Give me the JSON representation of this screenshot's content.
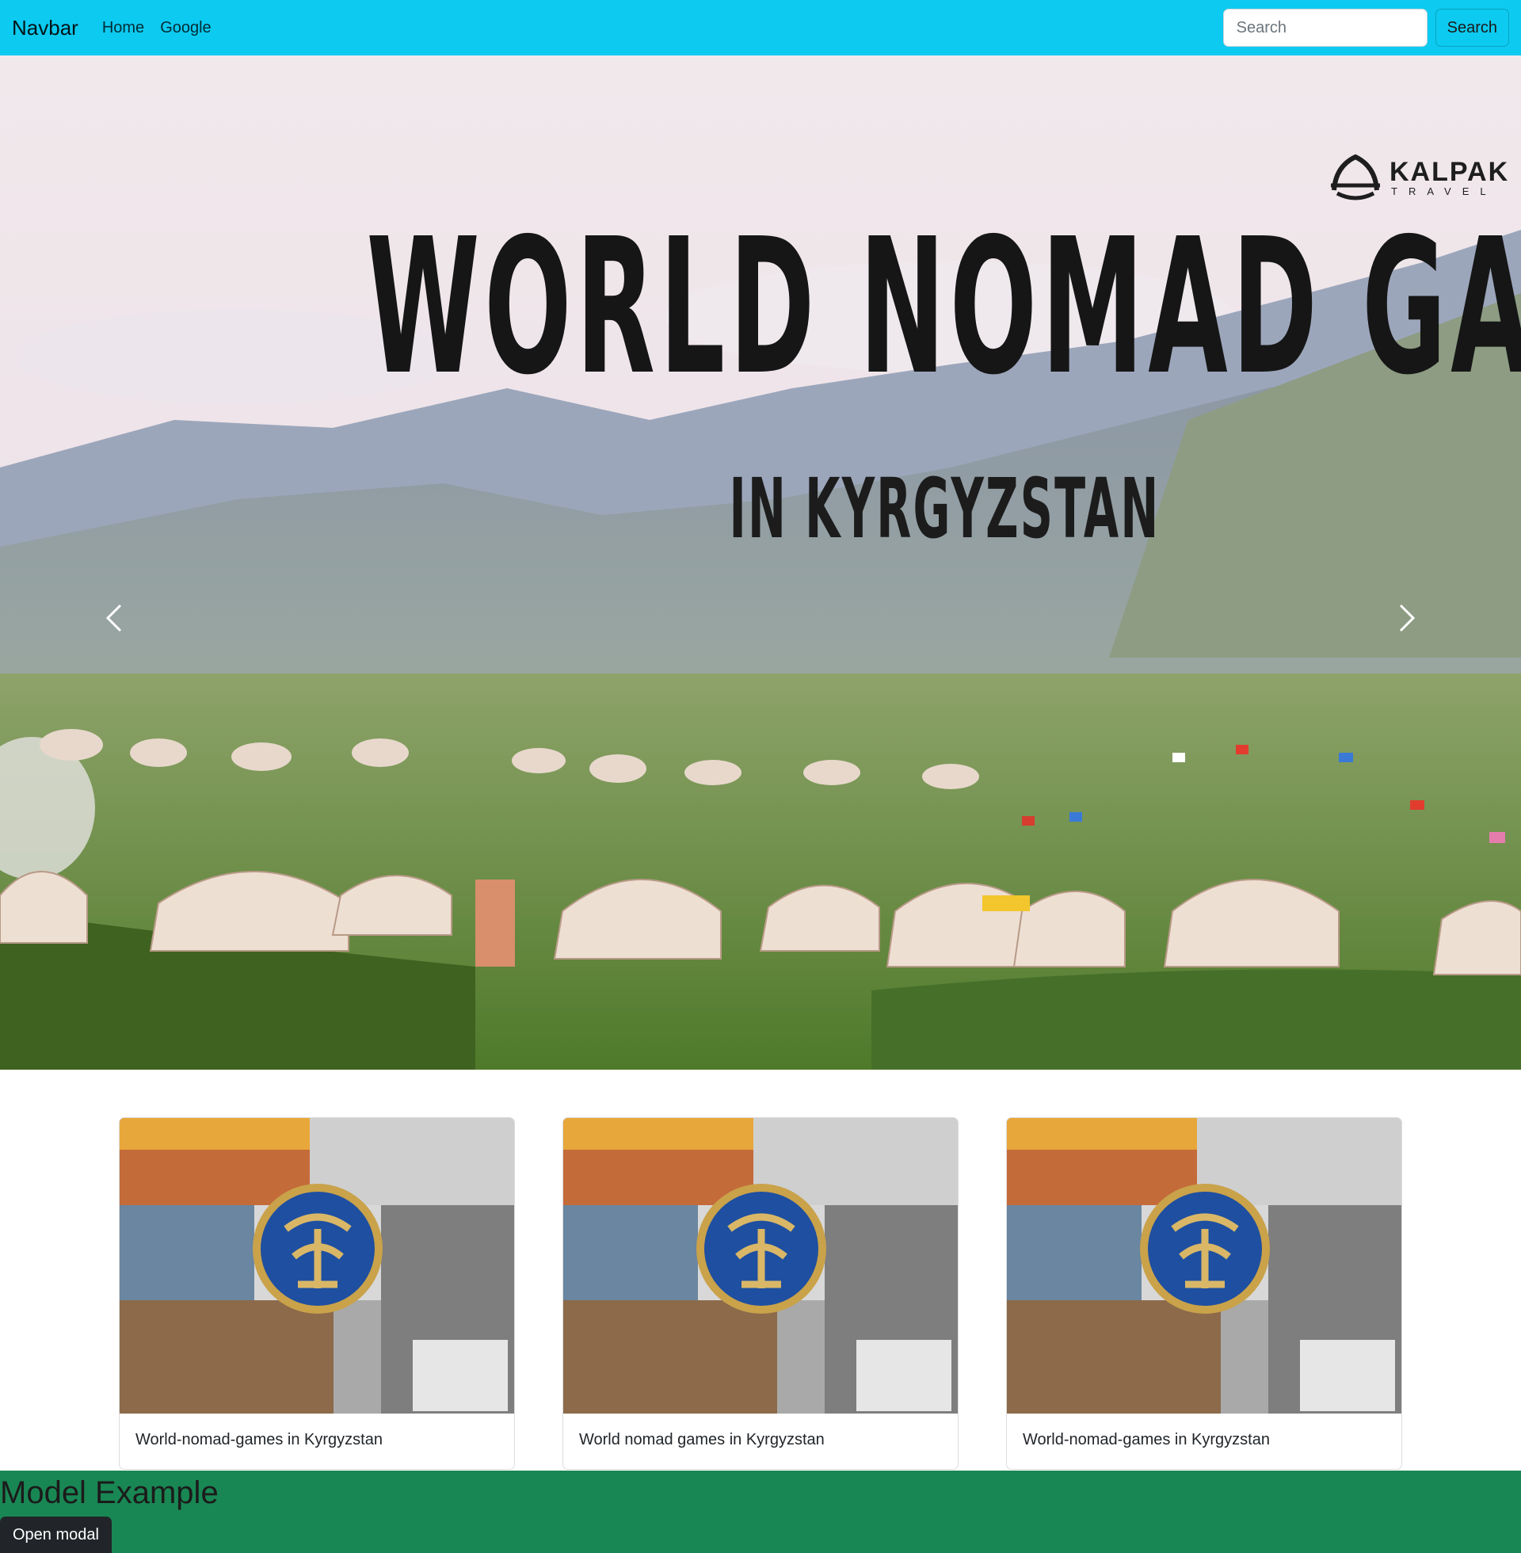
{
  "navbar": {
    "brand": "Navbar",
    "links": [
      "Home",
      "Google"
    ],
    "search_placeholder": "Search",
    "search_button": "Search",
    "bg_color": "#0dcaf0"
  },
  "carousel": {
    "title": "WORLD NOMAD GAMES",
    "subtitle": "IN KYRGYZSTAN",
    "logo_name": "KALPAK",
    "logo_tagline": "TRAVEL",
    "prev_icon": "chevron-left-icon",
    "next_icon": "chevron-right-icon"
  },
  "cards": [
    {
      "text": "World-nomad-games in Kyrgyzstan"
    },
    {
      "text": "World nomad games in Kyrgyzstan"
    },
    {
      "text": "World-nomad-games in Kyrgyzstan"
    }
  ],
  "modal_section": {
    "heading": "Model Example",
    "button": "Open modal",
    "bg_color": "#198754"
  }
}
